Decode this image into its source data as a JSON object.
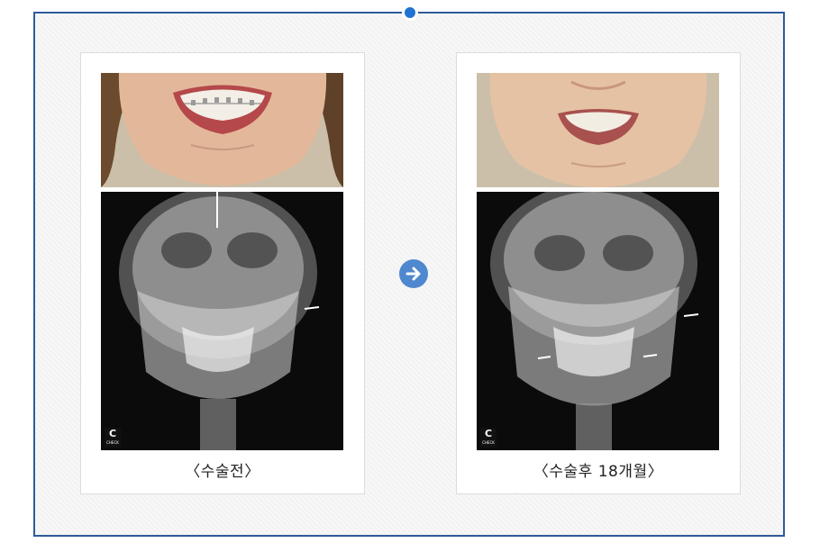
{
  "comparison": {
    "before": {
      "caption": "〈수술전〉",
      "photo_icon": "smile-braces-photo",
      "xray_icon": "skull-xray-frontal"
    },
    "arrow_icon": "arrow-right-circle-icon",
    "after": {
      "caption": "〈수술후 18개월〉",
      "photo_icon": "smile-photo",
      "xray_icon": "skull-xray-frontal-postop"
    }
  },
  "watermark": {
    "letter": "C",
    "sub": "CHECK"
  },
  "colors": {
    "frame_border": "#2f5b9a",
    "top_dot": "#1f73d1",
    "arrow": "#4f88cf"
  }
}
